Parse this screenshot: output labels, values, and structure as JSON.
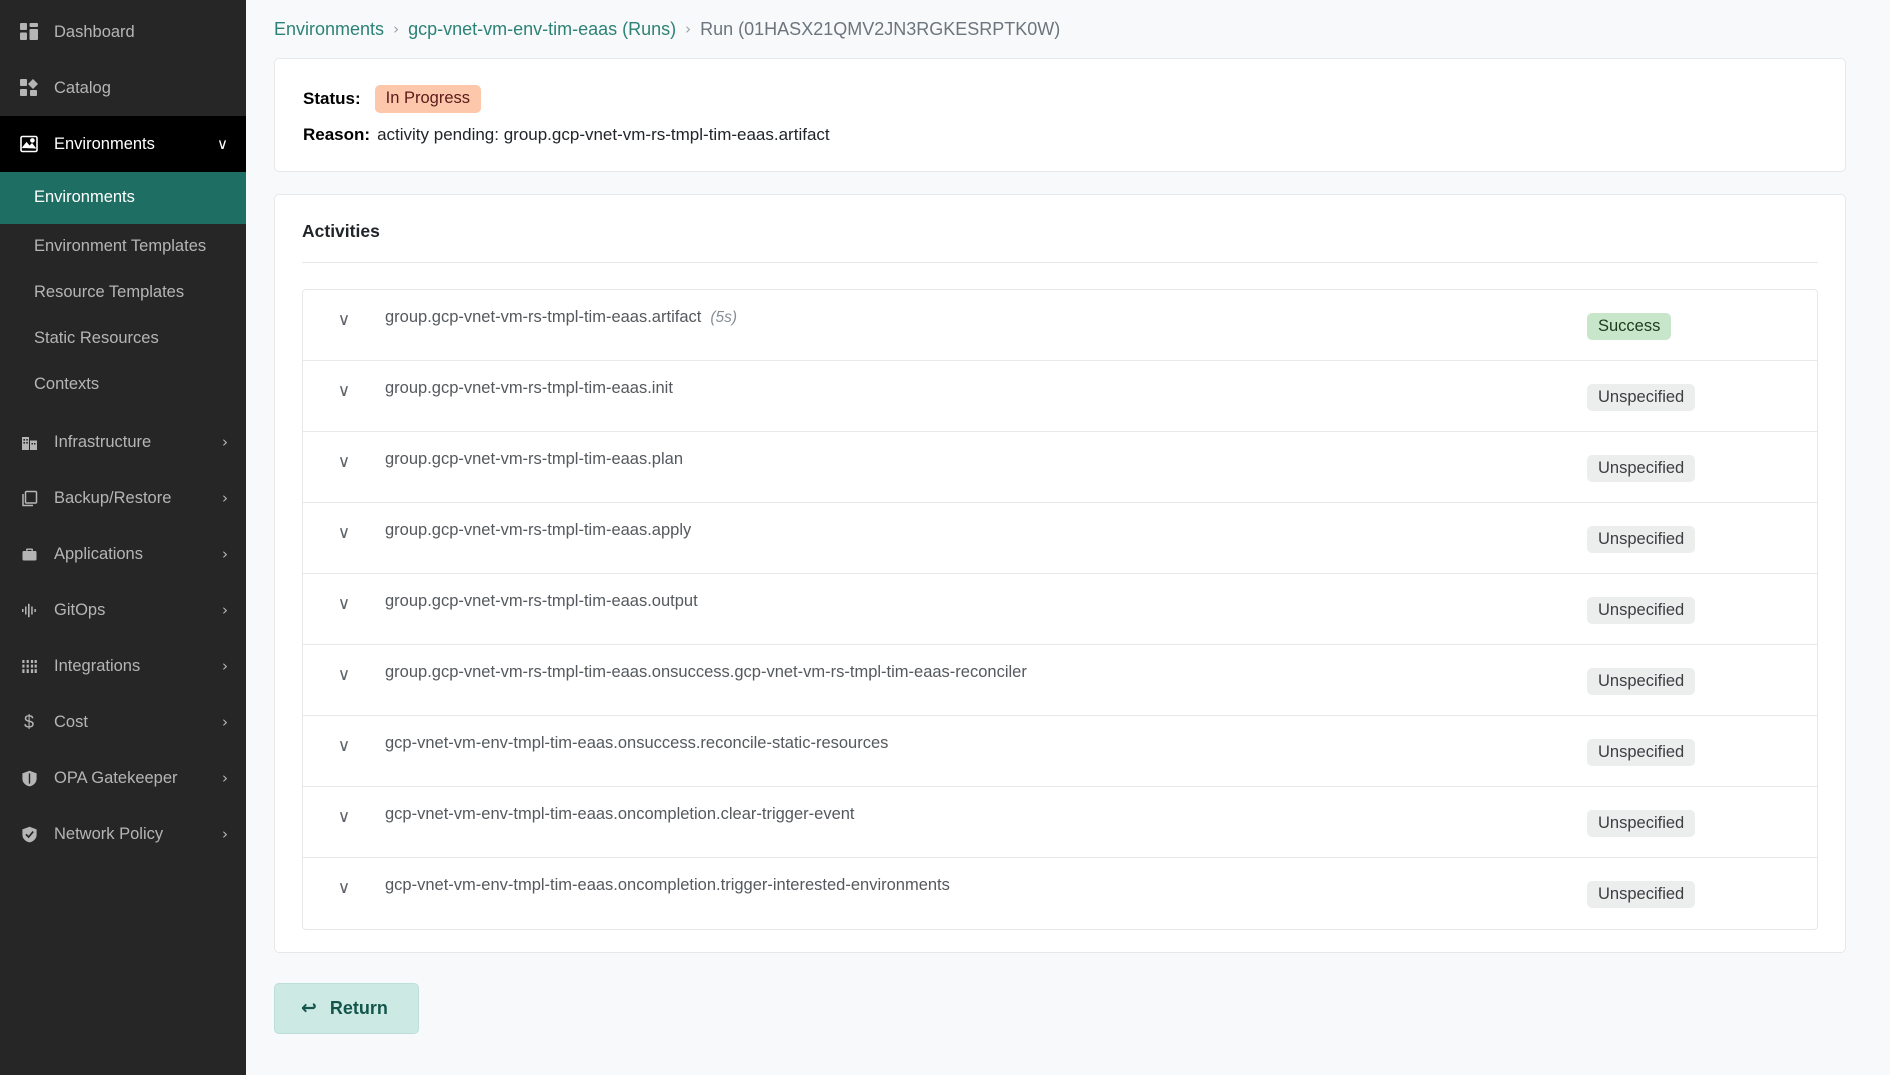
{
  "sidebar": {
    "items": [
      {
        "label": "Dashboard",
        "icon": "dashboard-icon",
        "expandable": false,
        "state": "normal"
      },
      {
        "label": "Catalog",
        "icon": "catalog-icon",
        "expandable": false,
        "state": "normal"
      },
      {
        "label": "Environments",
        "icon": "environments-icon",
        "expandable": true,
        "state": "expanded",
        "caret": "∨"
      }
    ],
    "sub_items": [
      {
        "label": "Environments",
        "selected": true
      },
      {
        "label": "Environment Templates",
        "selected": false
      },
      {
        "label": "Resource Templates",
        "selected": false
      },
      {
        "label": "Static Resources",
        "selected": false
      },
      {
        "label": "Contexts",
        "selected": false
      }
    ],
    "items_after": [
      {
        "label": "Infrastructure",
        "icon": "infrastructure-icon",
        "expandable": true,
        "caret": "›"
      },
      {
        "label": "Backup/Restore",
        "icon": "backup-restore-icon",
        "expandable": true,
        "caret": "›"
      },
      {
        "label": "Applications",
        "icon": "applications-icon",
        "expandable": true,
        "caret": "›"
      },
      {
        "label": "GitOps",
        "icon": "gitops-icon",
        "expandable": true,
        "caret": "›"
      },
      {
        "label": "Integrations",
        "icon": "integrations-icon",
        "expandable": true,
        "caret": "›"
      },
      {
        "label": "Cost",
        "icon": "cost-icon",
        "expandable": true,
        "caret": "›"
      },
      {
        "label": "OPA Gatekeeper",
        "icon": "opa-gatekeeper-icon",
        "expandable": true,
        "caret": "›"
      },
      {
        "label": "Network Policy",
        "icon": "network-policy-icon",
        "expandable": true,
        "caret": "›"
      }
    ],
    "colors": {
      "background": "#262626",
      "active_parent": "#000000",
      "selected": "#1f6e63",
      "text": "#b5b5b5"
    }
  },
  "breadcrumb": {
    "root": "Environments",
    "parent": "gcp-vnet-vm-env-tim-eaas (Runs)",
    "current": "Run (01HASX21QMV2JN3RGKESRPTK0W)",
    "separator": "›"
  },
  "status_card": {
    "status_label": "Status:",
    "status_value": "In Progress",
    "status_color": "#fcc7ab",
    "status_text_color": "#5c1a1a",
    "reason_label": "Reason:",
    "reason_value": "activity pending: group.gcp-vnet-vm-rs-tmpl-tim-eaas.artifact"
  },
  "activities": {
    "title": "Activities",
    "chevron": "∨",
    "rows": [
      {
        "name": "group.gcp-vnet-vm-rs-tmpl-tim-eaas.artifact",
        "duration": "(5s)",
        "status": "Success",
        "status_kind": "success"
      },
      {
        "name": "group.gcp-vnet-vm-rs-tmpl-tim-eaas.init",
        "duration": "",
        "status": "Unspecified",
        "status_kind": "unspecified"
      },
      {
        "name": "group.gcp-vnet-vm-rs-tmpl-tim-eaas.plan",
        "duration": "",
        "status": "Unspecified",
        "status_kind": "unspecified"
      },
      {
        "name": "group.gcp-vnet-vm-rs-tmpl-tim-eaas.apply",
        "duration": "",
        "status": "Unspecified",
        "status_kind": "unspecified"
      },
      {
        "name": "group.gcp-vnet-vm-rs-tmpl-tim-eaas.output",
        "duration": "",
        "status": "Unspecified",
        "status_kind": "unspecified"
      },
      {
        "name": "group.gcp-vnet-vm-rs-tmpl-tim-eaas.onsuccess.gcp-vnet-vm-rs-tmpl-tim-eaas-reconciler",
        "duration": "",
        "status": "Unspecified",
        "status_kind": "unspecified"
      },
      {
        "name": "gcp-vnet-vm-env-tmpl-tim-eaas.onsuccess.reconcile-static-resources",
        "duration": "",
        "status": "Unspecified",
        "status_kind": "unspecified"
      },
      {
        "name": "gcp-vnet-vm-env-tmpl-tim-eaas.oncompletion.clear-trigger-event",
        "duration": "",
        "status": "Unspecified",
        "status_kind": "unspecified"
      },
      {
        "name": "gcp-vnet-vm-env-tmpl-tim-eaas.oncompletion.trigger-interested-environments",
        "duration": "",
        "status": "Unspecified",
        "status_kind": "unspecified"
      }
    ]
  },
  "footer": {
    "return_label": "Return",
    "return_icon": "↩"
  }
}
